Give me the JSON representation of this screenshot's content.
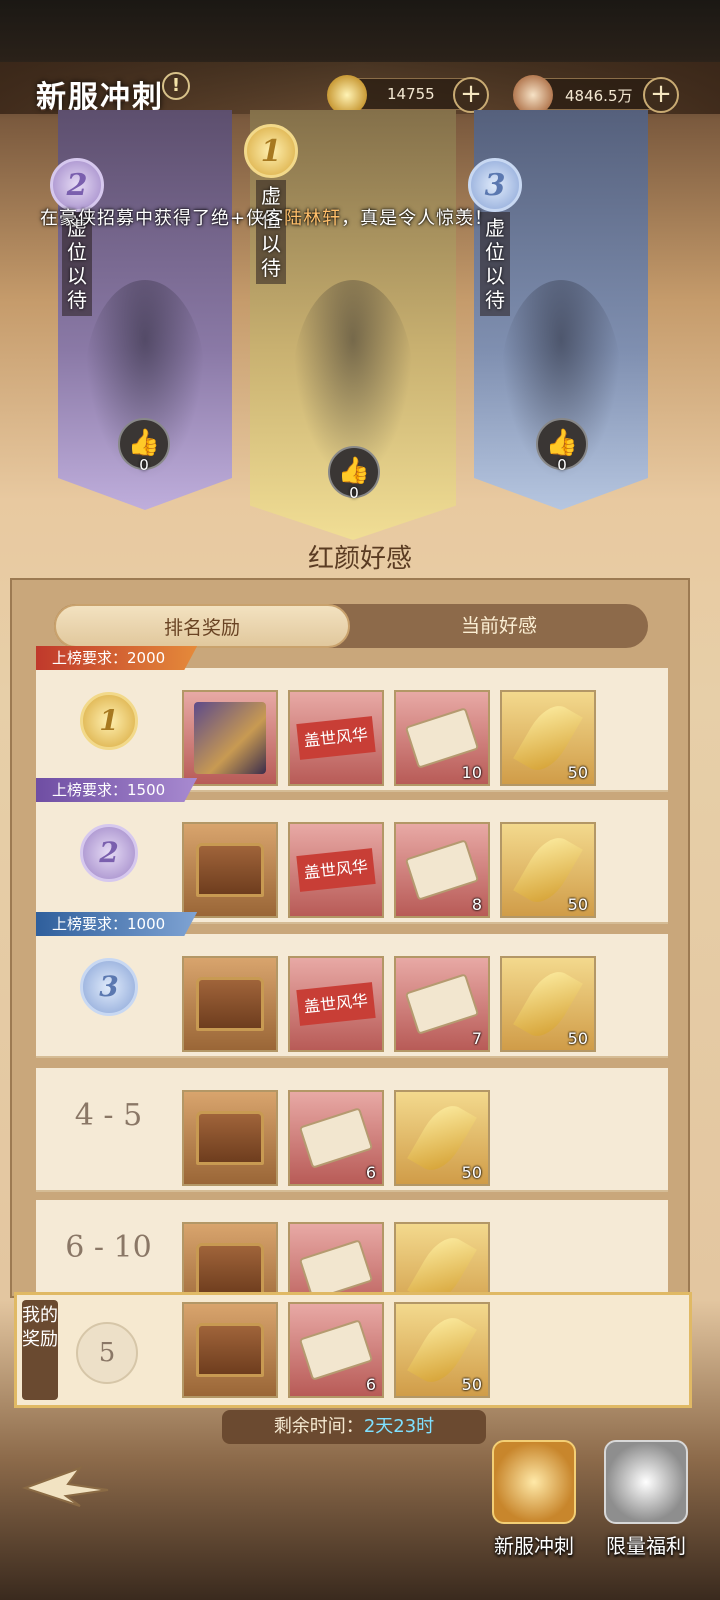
{
  "header": {
    "title": "新服冲刺",
    "info_icon": "!",
    "gold": "14755",
    "coins": "4846.5万",
    "plus": "+"
  },
  "top3": [
    {
      "rank": "2",
      "name": "虚位以待",
      "likes": "0"
    },
    {
      "rank": "1",
      "name": "虚位以待",
      "likes": "0"
    },
    {
      "rank": "3",
      "name": "虚位以待",
      "likes": "0"
    }
  ],
  "marquee": {
    "prefix": "在豪侠招募中获得了绝+侠客",
    "hero": "陆林轩",
    "suffix": "，真是令人惊羡！"
  },
  "section_title": "红颜好感",
  "tabs": [
    "排名奖励",
    "当前好感"
  ],
  "rows": [
    {
      "label": "上榜要求：2000",
      "rank": "1",
      "items": [
        {
          "type": "heroes",
          "count": ""
        },
        {
          "type": "banner",
          "text": "盖世风华",
          "count": ""
        },
        {
          "type": "scroll",
          "count": "10"
        },
        {
          "type": "leaf",
          "count": "50"
        }
      ]
    },
    {
      "label": "上榜要求：1500",
      "rank": "2",
      "items": [
        {
          "type": "chest",
          "count": ""
        },
        {
          "type": "banner",
          "text": "盖世风华",
          "count": ""
        },
        {
          "type": "scroll",
          "count": "8"
        },
        {
          "type": "leaf",
          "count": "50"
        }
      ]
    },
    {
      "label": "上榜要求：1000",
      "rank": "3",
      "items": [
        {
          "type": "chest",
          "count": ""
        },
        {
          "type": "banner",
          "text": "盖世风华",
          "count": ""
        },
        {
          "type": "scroll",
          "count": "7"
        },
        {
          "type": "leaf",
          "count": "50"
        }
      ]
    },
    {
      "label": "",
      "rank_text": "4 - 5",
      "items": [
        {
          "type": "chest",
          "count": ""
        },
        {
          "type": "scroll",
          "count": "6"
        },
        {
          "type": "leaf",
          "count": "50"
        }
      ]
    },
    {
      "label": "",
      "rank_text": "6 - 10",
      "items": [
        {
          "type": "chest",
          "count": ""
        },
        {
          "type": "scroll",
          "count": ""
        },
        {
          "type": "leaf",
          "count": ""
        }
      ]
    }
  ],
  "my_reward": {
    "label": "我的奖励",
    "rank": "5",
    "items": [
      {
        "type": "chest",
        "count": ""
      },
      {
        "type": "scroll",
        "count": "6"
      },
      {
        "type": "leaf",
        "count": "50"
      }
    ]
  },
  "timer": {
    "label": "剩余时间：",
    "value": "2天23时"
  },
  "nav": [
    {
      "label": "新服冲刺"
    },
    {
      "label": "限量福利"
    }
  ],
  "colors": {
    "rank1": "#e8c35a",
    "rank2": "#a88ad0",
    "rank3": "#8aa6d6",
    "accent": "#ffbf6a"
  }
}
